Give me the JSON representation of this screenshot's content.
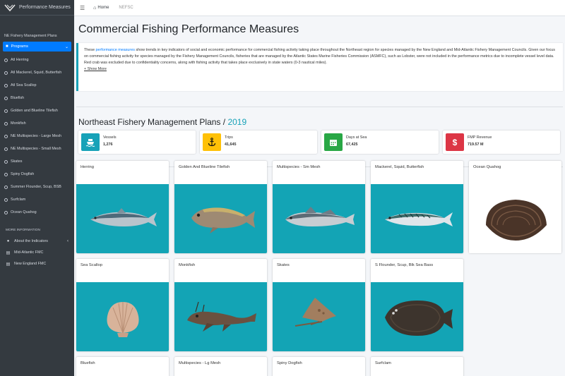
{
  "app": {
    "title": "Performance Measures"
  },
  "topnav": {
    "home": "Home",
    "crumb": "NEFSC"
  },
  "sidebar": {
    "section_title": "NE Fishery Management Plans",
    "programs_label": "Programs",
    "items": [
      {
        "label": "Atl Herring"
      },
      {
        "label": "Atl Mackerel, Squid, Butterfish"
      },
      {
        "label": "Atl Sea Scallop"
      },
      {
        "label": "Bluefish"
      },
      {
        "label": "Golden and Blueline Tilefish"
      },
      {
        "label": "Monkfish"
      },
      {
        "label": "NE Multispecies - Large Mesh"
      },
      {
        "label": "NE Multispecies - Small Mesh"
      },
      {
        "label": "Skates"
      },
      {
        "label": "Spiny Dogfish"
      },
      {
        "label": "Summer Flounder, Scup, BSB"
      },
      {
        "label": "Surfclam"
      },
      {
        "label": "Ocean Quahog"
      }
    ],
    "more_info_title": "MORE INFORMATION",
    "more_items": [
      {
        "label": "About the Indicators"
      },
      {
        "label": "Mid-Atlantic FMC"
      },
      {
        "label": "New England FMC"
      }
    ]
  },
  "page": {
    "title": "Commercial Fishing Performance Measures",
    "intro_pre": "These ",
    "intro_link": "performance measures",
    "intro_post": " show trends in key indicators of social and economic performance for commercial fishing activity taking place throughout the Northeast region for species managed by the New England and Mid-Atlantic Fishery Management Councils. Given our focus on commercial fishing activity for species managed by the Fishery Management Councils, fisheries that are managed by the Atlantic States Marine Fisheries Commission (ASMFC), such as Lobster, were not included in the performance metrics due to incomplete vessel level data. Red crab was excluded due to confidentiality concerns, along with fishing activity that takes place exclusively in state waters (0-3 nautical miles).",
    "show_more": "+ Show More",
    "subtitle": "Northeast Fishery Management Plans",
    "subtitle_sep": " / ",
    "year": "2019"
  },
  "stats": [
    {
      "label": "Vessels",
      "value": "1,276",
      "color": "#17a2b8",
      "icon": "ship-icon"
    },
    {
      "label": "Trips",
      "value": "41,645",
      "color": "#ffc107",
      "icon": "anchor-icon"
    },
    {
      "label": "Days at Sea",
      "value": "67,425",
      "color": "#28a745",
      "icon": "calendar-icon"
    },
    {
      "label": "FMP Revenue",
      "value": "719.57 M",
      "color": "#dc3545",
      "icon": "dollar-icon"
    }
  ],
  "cards": [
    {
      "title": "Herring",
      "icon": "herring-icon"
    },
    {
      "title": "Golden And Blueline Tilefish",
      "icon": "tilefish-icon"
    },
    {
      "title": "Multispecies - Sm Mesh",
      "icon": "hake-icon"
    },
    {
      "title": "Mackerel, Squid, Butterfish",
      "icon": "mackerel-icon"
    },
    {
      "title": "Ocean Quahog",
      "icon": "quahog-icon"
    },
    {
      "title": "Sea Scallop",
      "icon": "scallop-icon"
    },
    {
      "title": "Monkfish",
      "icon": "monkfish-icon"
    },
    {
      "title": "Skates",
      "icon": "skate-icon"
    },
    {
      "title": "S Flounder, Scup, Blk Sea Bass",
      "icon": "flounder-icon"
    },
    {
      "title": "Bluefish",
      "icon": "bluefish-icon"
    },
    {
      "title": "Multispecies - Lg Mesh",
      "icon": "cod-icon"
    },
    {
      "title": "Spiny Dogfish",
      "icon": "dogfish-icon"
    },
    {
      "title": "Surfclam",
      "icon": "surfclam-icon"
    }
  ]
}
